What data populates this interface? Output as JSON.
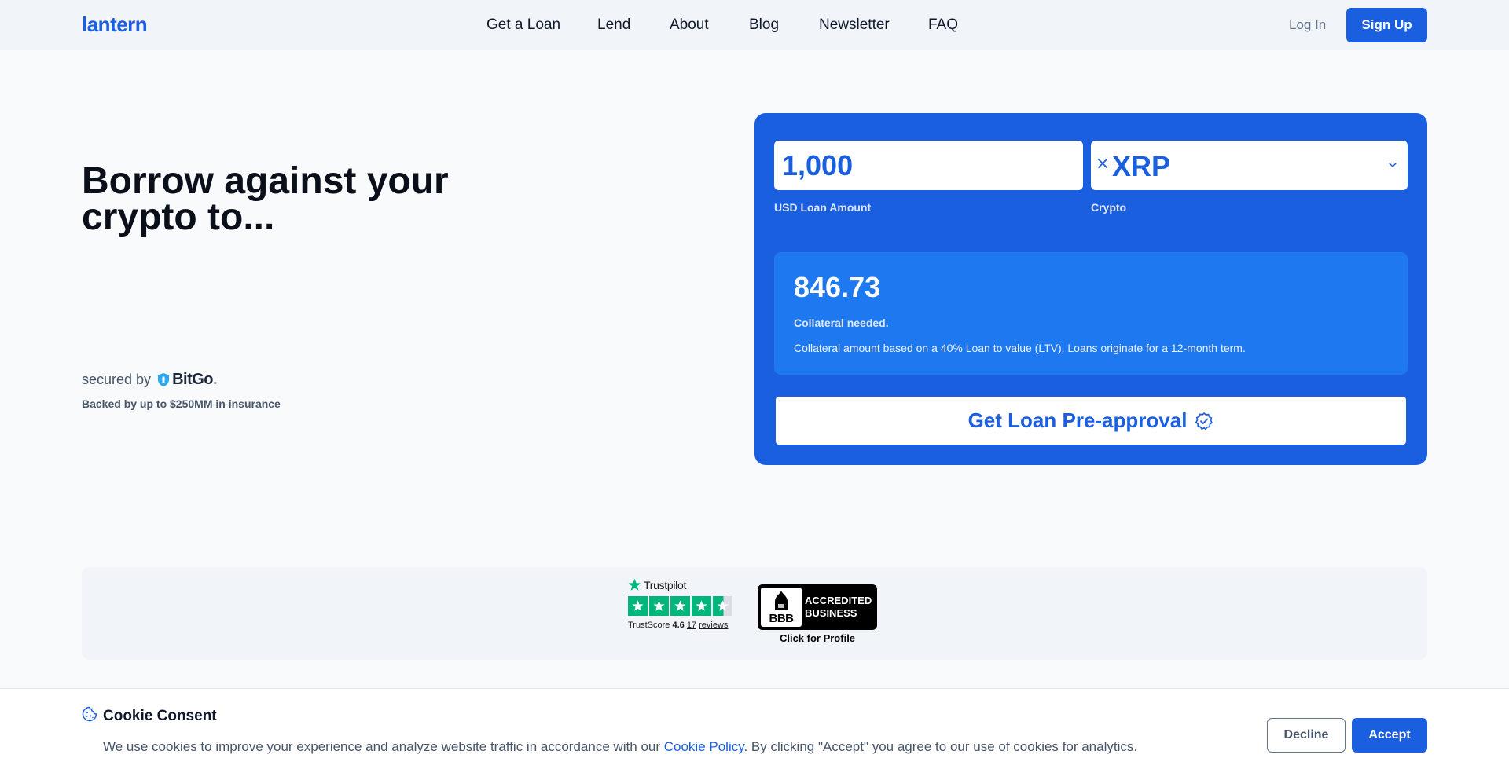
{
  "header": {
    "logo": "lantern",
    "nav": [
      "Get a Loan",
      "Lend",
      "About",
      "Blog",
      "Newsletter",
      "FAQ"
    ],
    "login_label": "Log In",
    "signup_label": "Sign Up"
  },
  "hero": {
    "title": "Borrow against your crypto to...",
    "secured_by": "secured by",
    "bitgo": "BitGo",
    "bitgo_dot": ".",
    "backed": "Backed by up to $250MM in insurance"
  },
  "calculator": {
    "amount_value": "1,000",
    "amount_label": "USD Loan Amount",
    "crypto_value": "XRP",
    "crypto_label": "Crypto",
    "collateral_amount": "846.73",
    "collateral_label": "Collateral needed.",
    "collateral_note": "Collateral amount based on a 40% Loan to value (LTV). Loans originate for a 12-month term.",
    "cta_label": "Get Loan Pre-approval"
  },
  "trust": {
    "trustpilot_name": "Trustpilot",
    "trustscore_label": "TrustScore",
    "trustscore_value": "4.6",
    "review_count": "17",
    "reviews_label": "reviews",
    "stars": 4.5,
    "bbb_seal": "BBB",
    "bbb_line1": "ACCREDITED",
    "bbb_line2": "BUSINESS",
    "bbb_profile": "Click for Profile"
  },
  "cookie": {
    "title": "Cookie Consent",
    "text_before": "We use cookies to improve your experience and analyze website traffic in accordance with our ",
    "link": "Cookie Policy",
    "text_after": ". By clicking \"Accept\" you agree to our use of cookies for analytics.",
    "decline_label": "Decline",
    "accept_label": "Accept"
  },
  "colors": {
    "brand": "#1a5fe0",
    "card_inner": "#1e78f0",
    "trustpilot_green": "#00b67a"
  },
  "icons": {
    "clear": "close-icon",
    "dropdown": "chevron-down-icon",
    "cta": "check-badge-icon",
    "cookie": "cookie-icon",
    "bitgo": "shield-icon",
    "trustpilot": "star-icon"
  }
}
